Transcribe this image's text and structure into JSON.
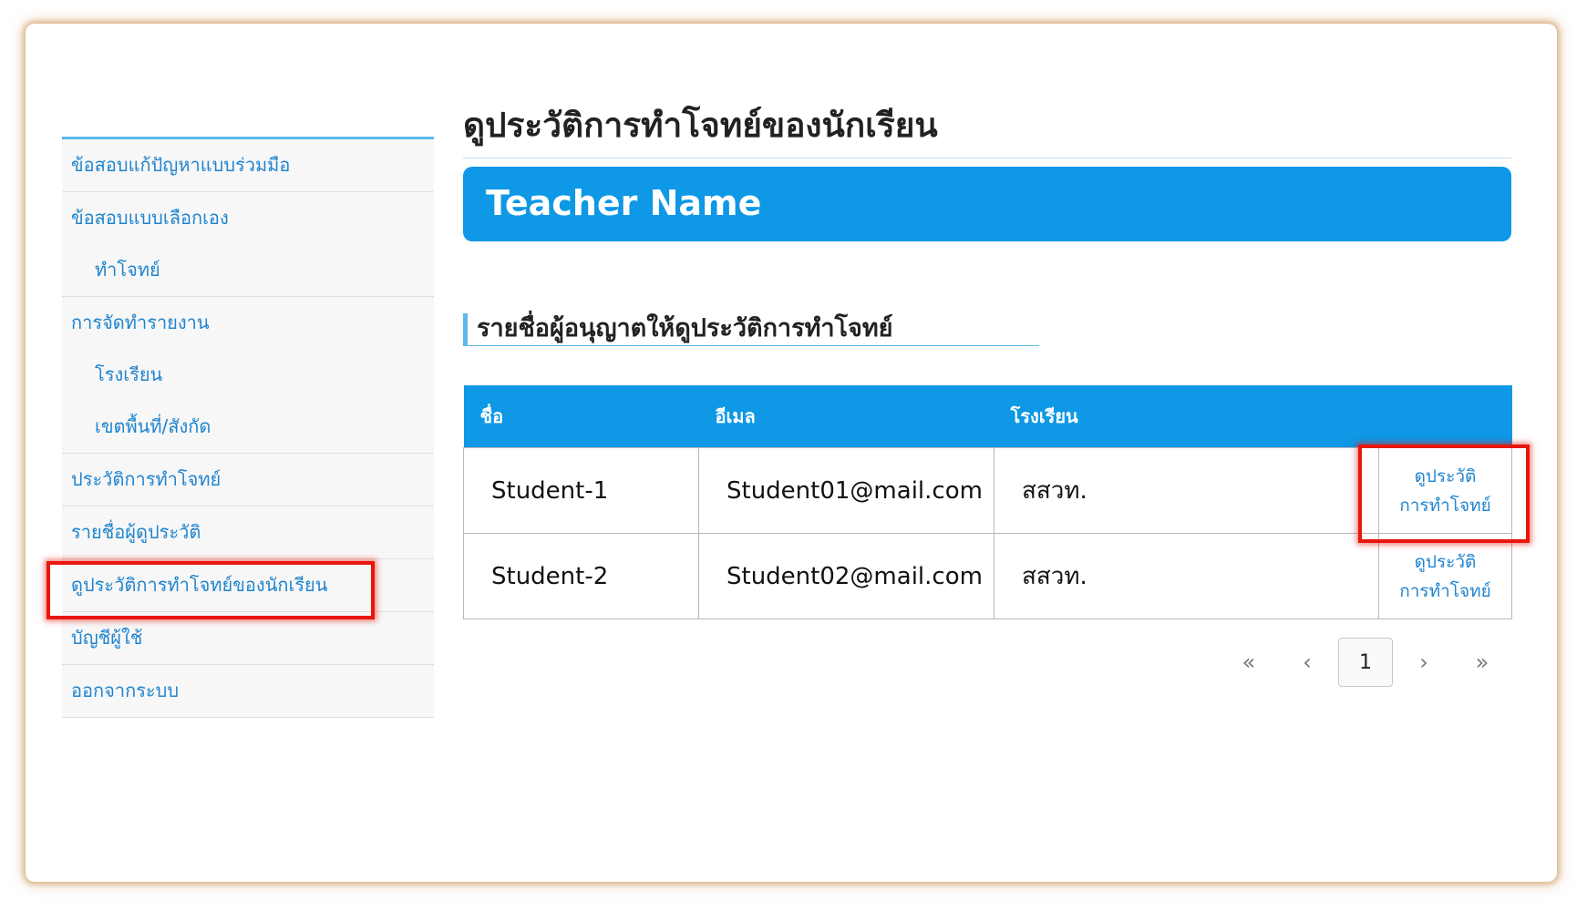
{
  "sidebar": {
    "items": [
      {
        "label": "ข้อสอบแก้ปัญหาแบบร่วมมือ"
      },
      {
        "label": "ข้อสอบแบบเลือกเอง"
      },
      {
        "label": "ทำโจทย์"
      },
      {
        "label": "การจัดทำรายงาน"
      },
      {
        "label": "โรงเรียน"
      },
      {
        "label": "เขตพื้นที่/สังกัด"
      },
      {
        "label": "ประวัติการทำโจทย์"
      },
      {
        "label": "รายชื่อผู้ดูประวัติ"
      },
      {
        "label": "ดูประวัติการทำโจทย์ของนักเรียน"
      },
      {
        "label": "บัญชีผู้ใช้"
      },
      {
        "label": "ออกจากระบบ"
      }
    ]
  },
  "main": {
    "page_title": "ดูประวัติการทำโจทย์ของนักเรียน",
    "teacher_name": "Teacher Name",
    "section_title": "รายชื่อผู้อนุญาตให้ดูประวัติการทำโจทย์",
    "table": {
      "headers": [
        "ชื่อ",
        "อีเมล",
        "โรงเรียน",
        ""
      ],
      "rows": [
        {
          "name": "Student-1",
          "email": "Student01@mail.com",
          "school": "สสวท.",
          "action_line1": "ดูประวัติ",
          "action_line2": "การทำโจทย์"
        },
        {
          "name": "Student-2",
          "email": "Student02@mail.com",
          "school": "สสวท.",
          "action_line1": "ดูประวัติ",
          "action_line2": "การทำโจทย์"
        }
      ]
    },
    "pagination": {
      "first": "«",
      "prev": "‹",
      "current": "1",
      "next": "›",
      "last": "»"
    }
  },
  "colors": {
    "accent": "#0e98e6",
    "link": "#1f84cf",
    "highlight": "#e8170c"
  }
}
